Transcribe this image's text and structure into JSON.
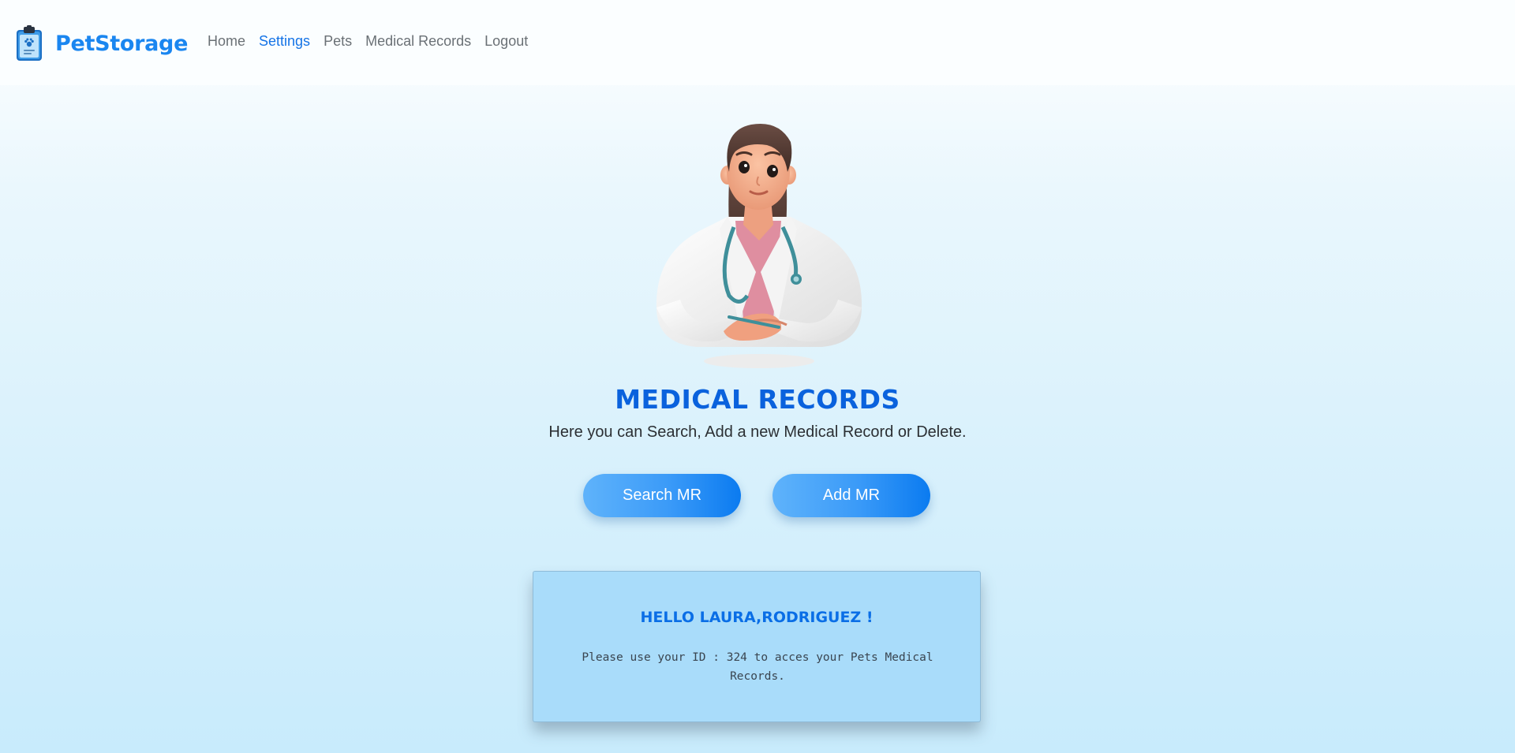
{
  "navbar": {
    "brand_name": "PetStorage",
    "brand_icon": "clipboard-paw-icon",
    "links": [
      {
        "label": "Home",
        "active": false
      },
      {
        "label": "Settings",
        "active": true
      },
      {
        "label": "Pets",
        "active": false
      },
      {
        "label": "Medical Records",
        "active": false
      },
      {
        "label": "Logout",
        "active": false
      }
    ]
  },
  "hero": {
    "illustration": "doctor-illustration",
    "title": "MEDICAL RECORDS",
    "subtitle": "Here you can Search, Add a new Medical Record or Delete."
  },
  "actions": {
    "search_label": "Search MR",
    "add_label": "Add MR"
  },
  "greeting": {
    "title": "HELLO LAURA,RODRIGUEZ !",
    "message": "Please use your ID : 324 to acces your Pets Medical Records."
  },
  "colors": {
    "brand": "#1a86f0",
    "nav_active": "#1473e6",
    "title": "#0a62dd",
    "button_start": "#5fb3fb",
    "button_end": "#0b7bf0",
    "card_bg": "#a9dcfa"
  }
}
